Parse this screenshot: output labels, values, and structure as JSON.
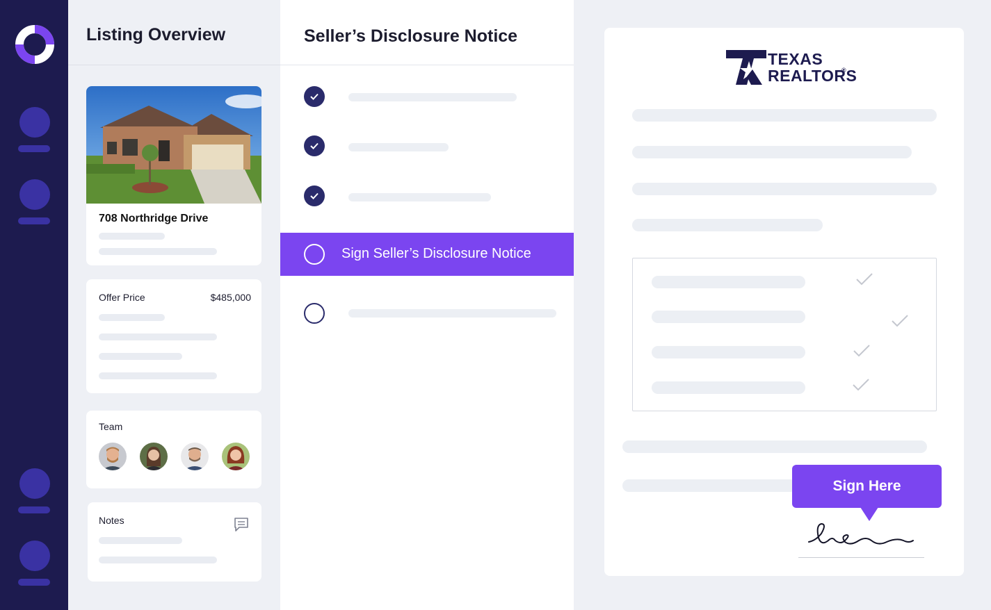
{
  "colors": {
    "rail_bg": "#1d1b4f",
    "rail_item": "#3a32a3",
    "accent_purple": "#7b45f0",
    "check_navy": "#2a2b6b",
    "page_bg": "#eef0f5"
  },
  "sidebar": {
    "logo_icon": "donut-logo-icon",
    "items": [
      "nav-item-1",
      "nav-item-2",
      "nav-item-3",
      "nav-item-4"
    ]
  },
  "listing": {
    "title": "Listing Overview",
    "address": "708 Northridge Drive",
    "offer_label": "Offer Price",
    "offer_value": "$485,000",
    "team_label": "Team",
    "team_members": 4,
    "notes_label": "Notes",
    "notes_icon": "comment-icon"
  },
  "disclosure": {
    "title": "Seller’s Disclosure Notice",
    "steps": [
      {
        "status": "complete"
      },
      {
        "status": "complete"
      },
      {
        "status": "complete"
      },
      {
        "status": "active",
        "label": "Sign Seller’s Disclosure Notice"
      },
      {
        "status": "pending"
      }
    ]
  },
  "document": {
    "logo_line1": "TEXAS",
    "logo_line2": "REALTORS",
    "logo_mark": "®",
    "sign_button": "Sign Here"
  }
}
